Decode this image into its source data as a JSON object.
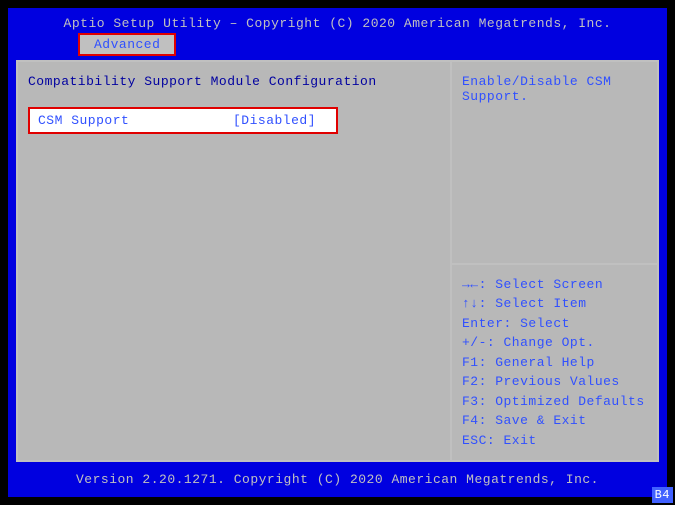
{
  "header": {
    "title": "Aptio Setup Utility – Copyright (C) 2020 American Megatrends, Inc.",
    "active_tab": "Advanced"
  },
  "main": {
    "section_title": "Compatibility Support Module Configuration",
    "settings": [
      {
        "label": "CSM Support",
        "value": "[Disabled]"
      }
    ]
  },
  "help": {
    "text": "Enable/Disable CSM Support."
  },
  "keys": [
    "→←: Select Screen",
    "↑↓: Select Item",
    "Enter: Select",
    "+/-: Change Opt.",
    "F1: General Help",
    "F2: Previous Values",
    "F3: Optimized Defaults",
    "F4: Save & Exit",
    "ESC: Exit"
  ],
  "footer": {
    "version": "Version 2.20.1271. Copyright (C) 2020 American Megatrends, Inc."
  },
  "badge": "B4"
}
